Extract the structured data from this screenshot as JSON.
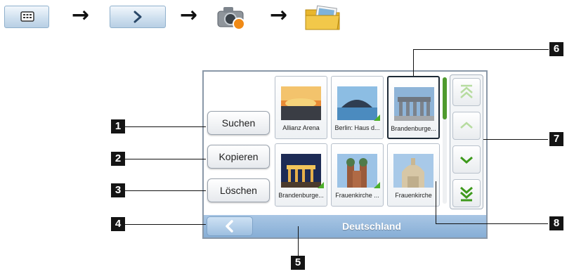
{
  "sidebar_buttons": {
    "search": "Suchen",
    "copy": "Kopieren",
    "delete": "Löschen"
  },
  "gallery": {
    "tiles": [
      {
        "label": "Allianz Arena",
        "selected": false
      },
      {
        "label": "Berlin: Haus d...",
        "selected": false
      },
      {
        "label": "Brandenburge...",
        "selected": true
      },
      {
        "label": "Brandenburge...",
        "selected": false
      },
      {
        "label": "Frauenkirche ...",
        "selected": false
      },
      {
        "label": "Frauenkirche",
        "selected": false
      }
    ]
  },
  "statusbar": {
    "title": "Deutschland"
  },
  "callouts": [
    "1",
    "2",
    "3",
    "4",
    "5",
    "6",
    "7",
    "8"
  ],
  "colors": {
    "accent": "#4caf2a",
    "statusbar": "#8fb4da"
  },
  "icons": {
    "step1": "keypad-icon",
    "step2": "chevron-right-icon",
    "step3": "camera-icon",
    "step4": "folder-pictures-icon",
    "nav": [
      "double-chevron-up-icon",
      "chevron-up-icon",
      "chevron-down-icon",
      "double-chevron-down-icon"
    ]
  }
}
